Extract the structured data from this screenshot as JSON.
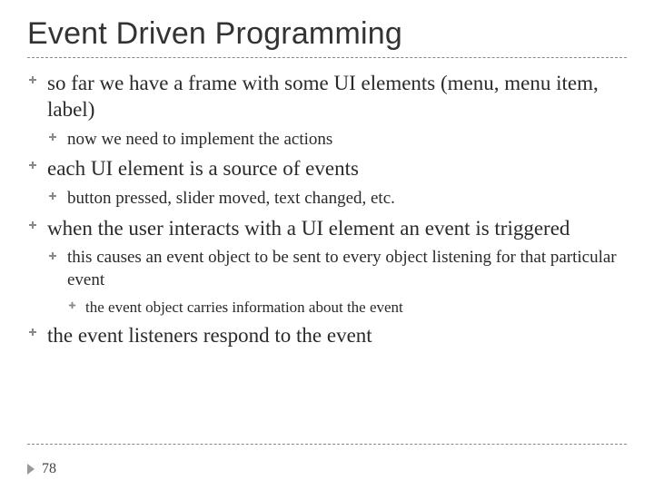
{
  "title": "Event Driven Programming",
  "bullets": {
    "b1": "so far we have a frame with some UI elements (menu, menu item, label)",
    "b1_1": "now we need to implement the actions",
    "b2": "each UI element is a source of events",
    "b2_1": "button pressed, slider moved, text changed, etc.",
    "b3": "when the user interacts with a UI element an event is triggered",
    "b3_1": "this causes an event object to be sent to every object listening for that particular event",
    "b3_1_1": "the event object carries information about the event",
    "b4": "the event listeners respond to the event"
  },
  "page_number": "78"
}
